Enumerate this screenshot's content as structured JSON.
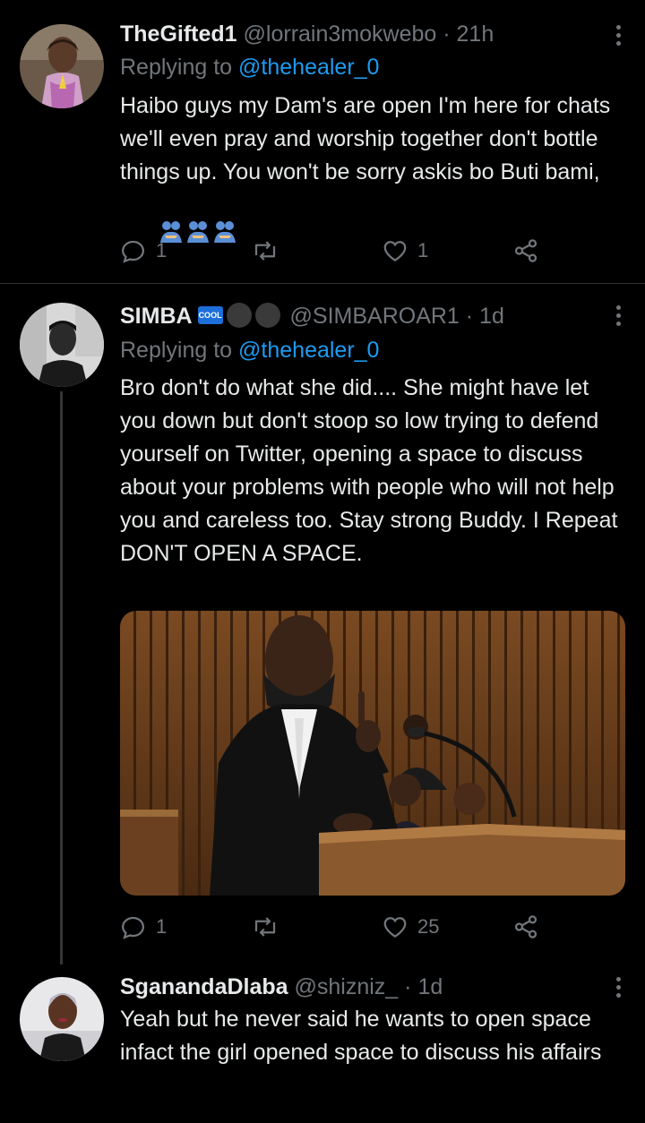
{
  "tweets": [
    {
      "name": "TheGifted1",
      "handle": "@lorrain3mokwebo",
      "time": "21h",
      "replying_label": "Replying to",
      "replying_to": "@thehealer_0",
      "text": "Haibo guys my Dam's are open I'm here for chats we'll even pray and worship together don't bottle things up. You won't be sorry askis bo Buti bami,",
      "emojis": [
        "🫂",
        "🫂",
        "🫂"
      ],
      "replies": "1",
      "retweets": "",
      "likes": "1"
    },
    {
      "name": "SIMBA",
      "badge": "COOL",
      "handle": "@SIMBAROAR1",
      "time": "1d",
      "replying_label": "Replying to",
      "replying_to": "@thehealer_0",
      "text": "Bro don't do what she did.... She might have let you down but don't stoop so low trying to defend yourself on Twitter, opening a space to discuss about your problems with people who will not help you and careless too. Stay strong Buddy. I Repeat DON'T OPEN A SPACE.",
      "media": "courtroom-photo",
      "replies": "1",
      "retweets": "",
      "likes": "25"
    },
    {
      "name": "SganandaDlaba",
      "handle": "@shizniz_",
      "time": "1d",
      "text": "Yeah but he never said he wants to open space infact the girl opened space to discuss his affairs"
    }
  ],
  "separator": "·",
  "colors": {
    "background": "#000000",
    "text": "#e7e9ea",
    "muted": "#71767b",
    "link": "#1d9bf0"
  }
}
